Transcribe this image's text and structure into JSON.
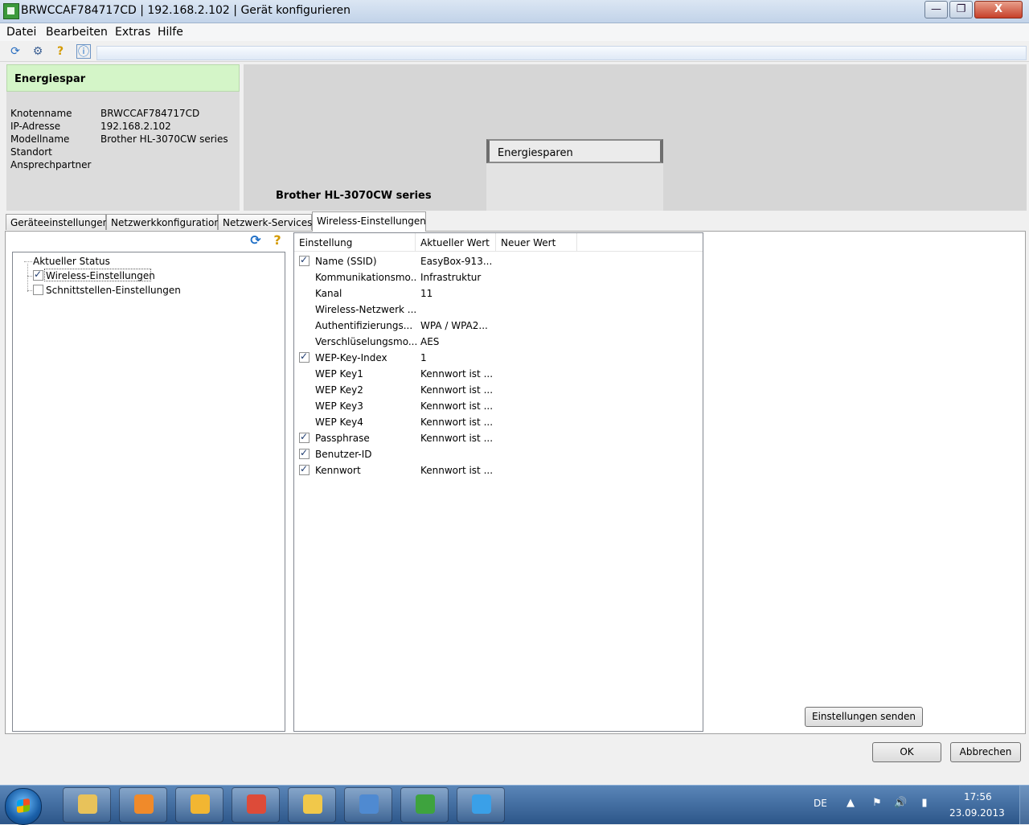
{
  "window": {
    "title": "BRWCCAF784717CD | 192.168.2.102 | Gerät konfigurieren",
    "min": "—",
    "max": "❐",
    "close": "X"
  },
  "menu": [
    "Datei",
    "Bearbeiten",
    "Extras",
    "Hilfe"
  ],
  "toolbar": {
    "icons": [
      "refresh-network-icon",
      "printer-settings-icon",
      "help-icon",
      "info-icon"
    ],
    "glyphs": [
      "⟳",
      "⚙",
      "?",
      "ⓘ"
    ]
  },
  "info": {
    "title": "Energiespar",
    "rows": [
      {
        "label": "Knotenname",
        "value": "BRWCCAF784717CD"
      },
      {
        "label": "IP-Adresse",
        "value": "192.168.2.102"
      },
      {
        "label": "Modellname",
        "value": "Brother HL-3070CW series"
      },
      {
        "label": "Standort",
        "value": ""
      },
      {
        "label": "Ansprechpartner",
        "value": ""
      }
    ]
  },
  "device": {
    "status": "Energiesparen",
    "caption": "Brother HL-3070CW series"
  },
  "tabs": [
    "Geräteeinstellungen",
    "Netzwerkkonfiguration",
    "Netzwerk-Services",
    "Wireless-Einstellungen"
  ],
  "active_tab": 3,
  "tree": {
    "root": "Aktueller Status",
    "items": [
      {
        "label": "Wireless-Einstellungen",
        "checked": true
      },
      {
        "label": "Schnittstellen-Einstellungen",
        "checked": false
      }
    ],
    "refresh_glyph": "⟳",
    "help_glyph": "?"
  },
  "list": {
    "headers": [
      "Einstellung",
      "Aktueller Wert",
      "Neuer Wert"
    ],
    "rows": [
      {
        "checkbox": true,
        "setting": "Name (SSID)",
        "current": "EasyBox-913..."
      },
      {
        "checkbox": false,
        "setting": "Kommunikationsmo...",
        "current": "Infrastruktur"
      },
      {
        "checkbox": false,
        "setting": "Kanal",
        "current": "11"
      },
      {
        "checkbox": false,
        "setting": "Wireless-Netzwerk ...",
        "current": ""
      },
      {
        "checkbox": false,
        "setting": "Authentifizierungs...",
        "current": "WPA / WPA2..."
      },
      {
        "checkbox": false,
        "setting": "Verschlüselungsmo...",
        "current": "AES"
      },
      {
        "checkbox": true,
        "setting": "WEP-Key-Index",
        "current": "1"
      },
      {
        "checkbox": false,
        "setting": "WEP Key1",
        "current": "Kennwort ist ..."
      },
      {
        "checkbox": false,
        "setting": "WEP Key2",
        "current": "Kennwort ist ..."
      },
      {
        "checkbox": false,
        "setting": "WEP Key3",
        "current": "Kennwort ist ..."
      },
      {
        "checkbox": false,
        "setting": "WEP Key4",
        "current": "Kennwort ist ..."
      },
      {
        "checkbox": true,
        "setting": "Passphrase",
        "current": "Kennwort ist ..."
      },
      {
        "checkbox": true,
        "setting": "Benutzer-ID",
        "current": ""
      },
      {
        "checkbox": true,
        "setting": "Kennwort",
        "current": "Kennwort ist ..."
      }
    ]
  },
  "buttons": {
    "send": "Einstellungen senden",
    "ok": "OK",
    "cancel": "Abbrechen"
  },
  "taskbar": {
    "apps": [
      {
        "name": "explorer-icon",
        "color": "#e8c25a"
      },
      {
        "name": "media-player-icon",
        "color": "#f08a2a"
      },
      {
        "name": "tools-icon",
        "color": "#f2b632"
      },
      {
        "name": "chrome-icon",
        "color": "#dd4b39"
      },
      {
        "name": "outlook-icon",
        "color": "#f1c84a"
      },
      {
        "name": "network-computers-icon",
        "color": "#4f8ad1"
      },
      {
        "name": "brother-config-icon",
        "color": "#3ea33e"
      },
      {
        "name": "internet-explorer-icon",
        "color": "#3aa0e8"
      }
    ],
    "lang": "DE",
    "tray_glyphs": [
      "▲",
      "⚑",
      "🔊",
      "▮"
    ],
    "time": "17:56",
    "date": "23.09.2013"
  }
}
